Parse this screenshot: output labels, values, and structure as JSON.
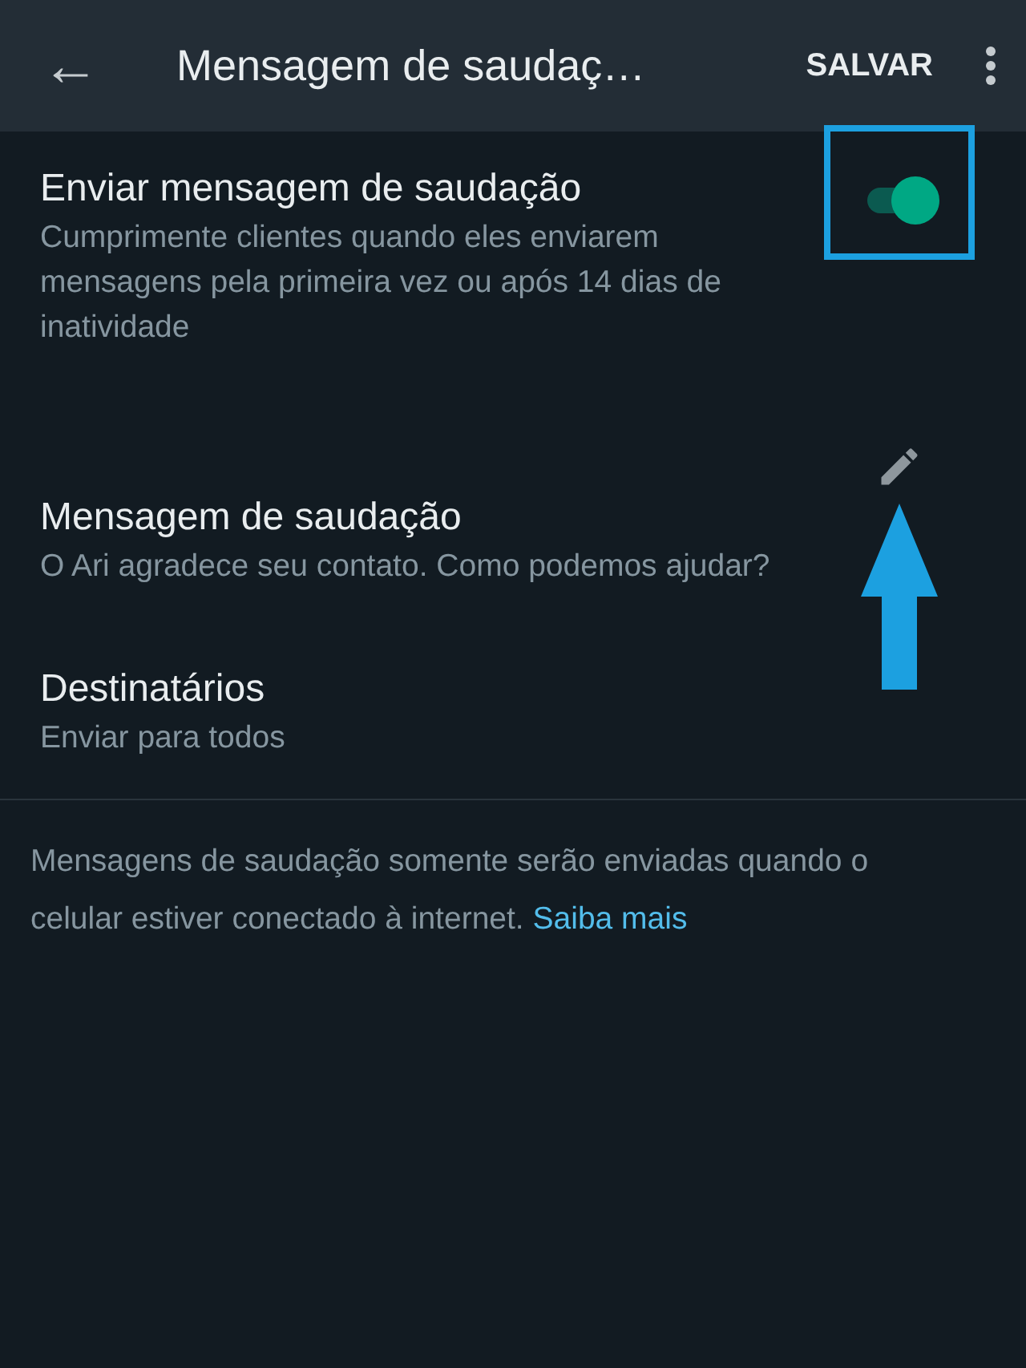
{
  "app_bar": {
    "back": "←",
    "title": "Mensagem de saudaç…",
    "action": "SALVAR"
  },
  "settings": [
    {
      "kind": "toggle",
      "title": "Enviar mensagem de saudação",
      "subtitle": "Cumprimente clientes quando eles enviarem mensagens pela primeira vez ou após 14 dias de inatividade",
      "on": true,
      "highlighted": true
    },
    {
      "kind": "edit",
      "title": "Mensagem de saudação",
      "subtitle": "O Ari agradece seu contato. Como podemos ajudar?",
      "pointed_at": true
    },
    {
      "kind": "plain",
      "title": "Destinatários",
      "subtitle": "Enviar para todos"
    }
  ],
  "footer": {
    "text": "Mensagens de saudação somente serão enviadas quando o celular estiver conectado à internet.",
    "link": "Saiba mais"
  }
}
